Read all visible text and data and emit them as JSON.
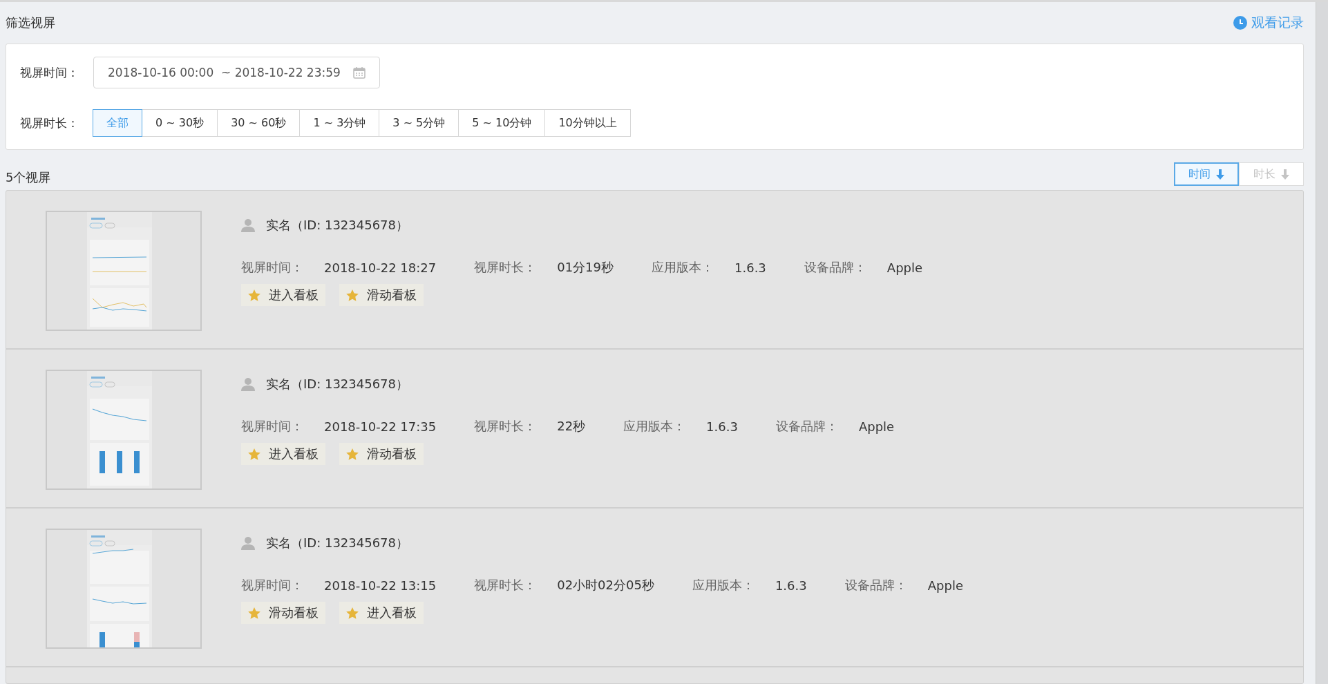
{
  "page_title": "筛选视屏",
  "history_link": "观看记录",
  "filters": {
    "time_label": "视屏时间：",
    "date_range": "2018-10-16 00:00  ~ 2018-10-22 23:59",
    "duration_label": "视屏时长：",
    "durations": [
      {
        "label": "全部",
        "selected": true
      },
      {
        "label": "0 ~ 30秒",
        "selected": false
      },
      {
        "label": "30 ~ 60秒",
        "selected": false
      },
      {
        "label": "1 ~ 3分钟",
        "selected": false
      },
      {
        "label": "3 ~ 5分钟",
        "selected": false
      },
      {
        "label": "5 ~ 10分钟",
        "selected": false
      },
      {
        "label": "10分钟以上",
        "selected": false
      }
    ]
  },
  "result_count": "5个视屏",
  "sort_buttons": [
    {
      "label": "时间",
      "selected": true
    },
    {
      "label": "时长",
      "selected": false
    }
  ],
  "records": [
    {
      "name": "实名（ID: 132345678）",
      "fields": [
        {
          "label": "视屏时间：",
          "value": "2018-10-22 18:27"
        },
        {
          "label": "视屏时长：",
          "value": "01分19秒"
        },
        {
          "label": "应用版本：",
          "value": "1.6.3"
        },
        {
          "label": "设备品牌：",
          "value": "Apple"
        }
      ],
      "tags": [
        "进入看板",
        "滑动看板"
      ]
    },
    {
      "name": "实名（ID: 132345678）",
      "fields": [
        {
          "label": "视屏时间：",
          "value": "2018-10-22 17:35"
        },
        {
          "label": "视屏时长：",
          "value": "22秒"
        },
        {
          "label": "应用版本：",
          "value": "1.6.3"
        },
        {
          "label": "设备品牌：",
          "value": "Apple"
        }
      ],
      "tags": [
        "进入看板",
        "滑动看板"
      ]
    },
    {
      "name": "实名（ID: 132345678）",
      "fields": [
        {
          "label": "视屏时间：",
          "value": "2018-10-22 13:15"
        },
        {
          "label": "视屏时长：",
          "value": "02小时02分05秒"
        },
        {
          "label": "应用版本：",
          "value": "1.6.3"
        },
        {
          "label": "设备品牌：",
          "value": "Apple"
        }
      ],
      "tags": [
        "滑动看板",
        "进入看板"
      ]
    }
  ]
}
